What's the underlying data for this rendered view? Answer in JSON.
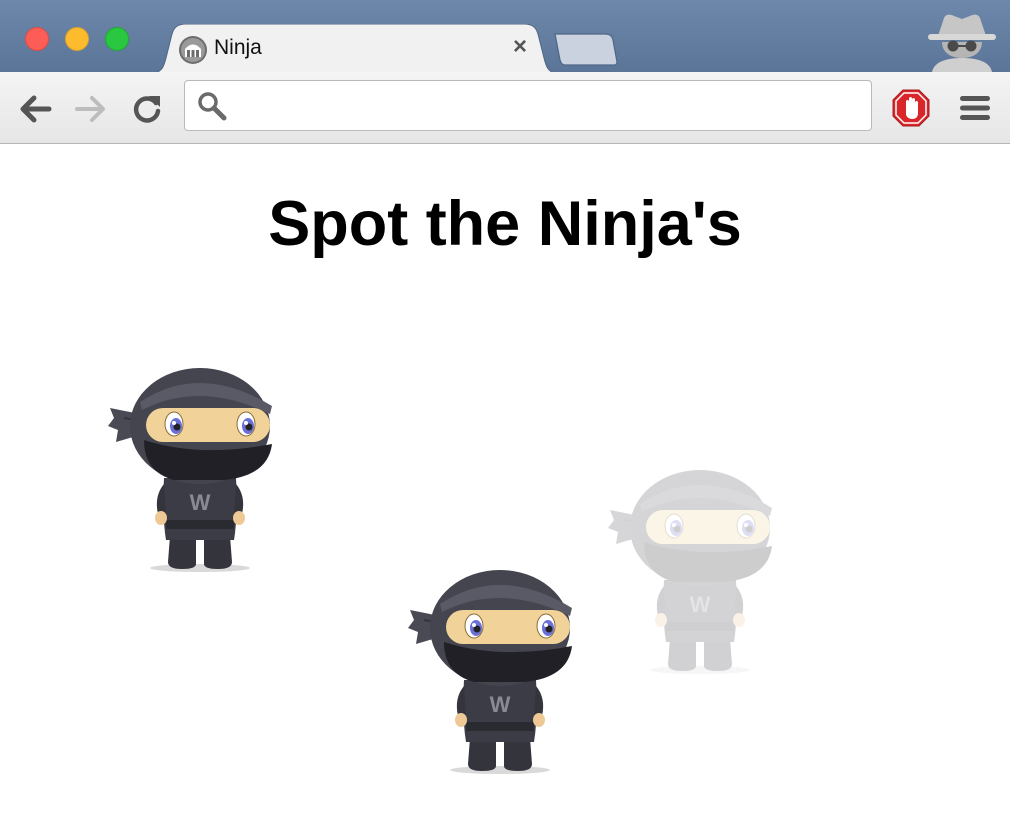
{
  "browser": {
    "tab": {
      "title": "Ninja",
      "close_label": "×",
      "favicon": "ninja-favicon"
    },
    "incognito_icon": "incognito-spy-icon",
    "toolbar": {
      "back_icon": "arrow-left-icon",
      "forward_icon": "arrow-right-icon",
      "reload_icon": "reload-icon",
      "address_value": "",
      "address_placeholder": "",
      "adblock_icon": "stop-hand-icon",
      "menu_icon": "hamburger-menu-icon"
    }
  },
  "page": {
    "heading": "Spot the Ninja's",
    "ninjas": [
      {
        "name": "ninja-1",
        "opacity": 1.0,
        "shirt_letter": "W"
      },
      {
        "name": "ninja-2",
        "opacity": 1.0,
        "shirt_letter": "W"
      },
      {
        "name": "ninja-3",
        "opacity": 0.22,
        "shirt_letter": "W"
      }
    ]
  },
  "colors": {
    "titlebar": "#5f7a9d",
    "close": "#fc5e57",
    "minimize": "#fdbc2e",
    "maximize": "#29c840",
    "adblock_red": "#d9262b",
    "ninja_suit": "#3a3a44",
    "ninja_skin": "#f1d39a"
  }
}
